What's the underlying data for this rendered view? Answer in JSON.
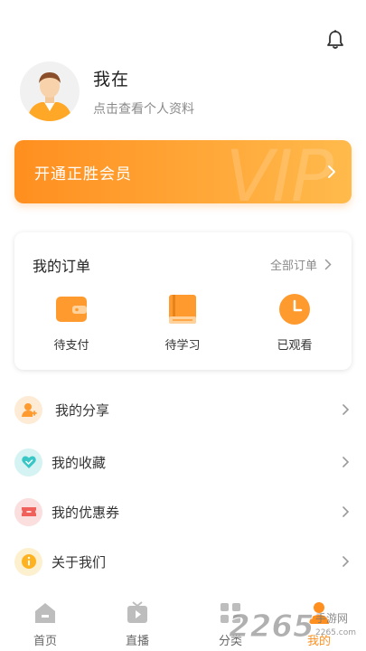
{
  "profile": {
    "name": "我在",
    "subtitle": "点击查看个人资料"
  },
  "vip": {
    "label": "开通正胜会员",
    "watermark": "VIP",
    "accent": "#ff9a2e"
  },
  "orders": {
    "title": "我的订单",
    "all_label": "全部订单",
    "items": [
      {
        "label": "待支付",
        "icon": "wallet-icon"
      },
      {
        "label": "待学习",
        "icon": "book-icon"
      },
      {
        "label": "已观看",
        "icon": "clock-icon"
      }
    ]
  },
  "menu": [
    {
      "label": "我的分享",
      "icon": "share-user-icon",
      "color": "#ff9a2e"
    },
    {
      "label": "我的收藏",
      "icon": "heart-icon",
      "color": "#39c6c6"
    },
    {
      "label": "我的优惠券",
      "icon": "coupon-icon",
      "color": "#f0615b"
    },
    {
      "label": "关于我们",
      "icon": "info-icon",
      "color": "#ffb21f"
    }
  ],
  "tabbar": [
    {
      "label": "首页",
      "icon": "home-icon"
    },
    {
      "label": "直播",
      "icon": "tv-icon"
    },
    {
      "label": "分类",
      "icon": "category-icon"
    },
    {
      "label": "我的",
      "icon": "user-icon",
      "active": true
    }
  ],
  "watermark": {
    "logo": "2265",
    "suffix": "手游网",
    "domain": "2265.com"
  }
}
